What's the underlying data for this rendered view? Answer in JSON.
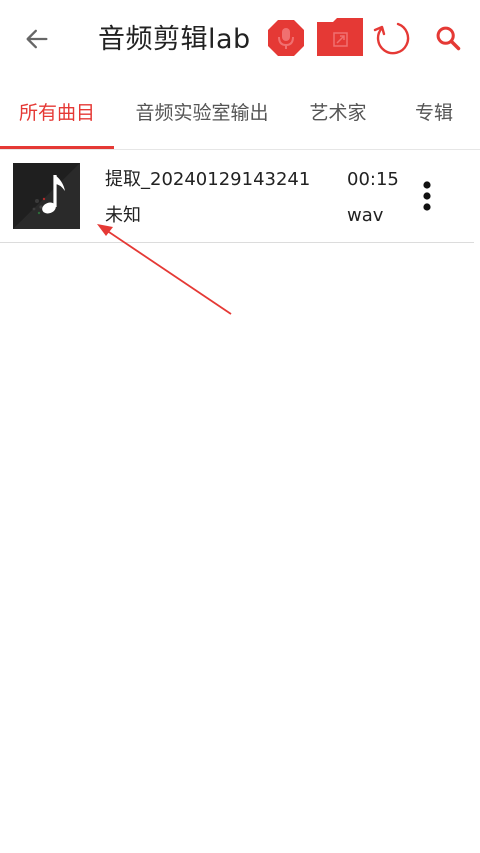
{
  "header": {
    "title": "音频剪辑lab",
    "icons": {
      "back": "arrow-left-icon",
      "mic": "microphone-icon",
      "folder": "folder-icon",
      "refresh": "refresh-icon",
      "search": "search-icon"
    },
    "accent_color": "#e53935"
  },
  "tabs": [
    {
      "label": "所有曲目",
      "active": true
    },
    {
      "label": "音频实验室输出",
      "active": false
    },
    {
      "label": "艺术家",
      "active": false
    },
    {
      "label": "专辑",
      "active": false
    }
  ],
  "tracks": [
    {
      "title": "提取_20240129143241",
      "artist": "未知",
      "duration": "00:15",
      "format": "wav",
      "art_icon": "music-note-icon",
      "menu_icon": "more-vertical-icon"
    }
  ]
}
